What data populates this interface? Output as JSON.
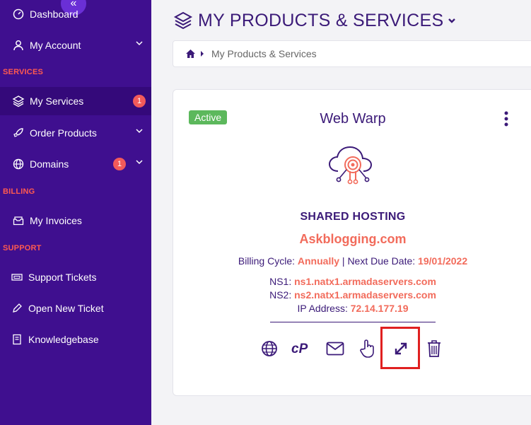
{
  "sidebar": {
    "collapse_glyph": "«",
    "items": [
      {
        "label": "Dashboard",
        "icon": "gauge-icon"
      },
      {
        "label": "My Account",
        "icon": "user-icon"
      },
      {
        "label": "My Services",
        "icon": "layers-icon",
        "badge": "1"
      },
      {
        "label": "Order Products",
        "icon": "rocket-icon"
      },
      {
        "label": "Domains",
        "icon": "globe-icon",
        "badge": "1"
      },
      {
        "label": "My Invoices",
        "icon": "invoice-icon"
      },
      {
        "label": "Support Tickets",
        "icon": "ticket-icon"
      },
      {
        "label": "Open New Ticket",
        "icon": "pencil-icon"
      },
      {
        "label": "Knowledgebase",
        "icon": "book-icon"
      }
    ],
    "sections": {
      "services": "SERVICES",
      "billing": "BILLING",
      "support": "SUPPORT"
    }
  },
  "header": {
    "title": "MY PRODUCTS & SERVICES"
  },
  "breadcrumb": {
    "current": "My Products & Services"
  },
  "service_card": {
    "status": "Active",
    "name": "Web Warp",
    "type": "SHARED HOSTING",
    "domain": "Askblogging.com",
    "billing_label": "Billing Cycle:",
    "billing_value": "Annually",
    "separator": "|",
    "due_label": "Next Due Date:",
    "due_value": "19/01/2022",
    "ns1_label": "NS1:",
    "ns1_value": "ns1.natx1.armadaservers.com",
    "ns2_label": "NS2:",
    "ns2_value": "ns2.natx1.armadaservers.com",
    "ip_label": "IP Address:",
    "ip_value": "72.14.177.19",
    "actions": [
      {
        "icon": "globe-icon"
      },
      {
        "icon": "cpanel-icon",
        "text": "cP"
      },
      {
        "icon": "envelope-icon"
      },
      {
        "icon": "hand-pointer-icon"
      },
      {
        "icon": "expand-icon"
      },
      {
        "icon": "trash-icon"
      }
    ]
  },
  "colors": {
    "sidebar_bg": "#3f0f8f",
    "accent": "#f26b5b",
    "primary_text": "#3b1a78",
    "active_badge": "#5cb85c",
    "highlight": "#e02020"
  }
}
